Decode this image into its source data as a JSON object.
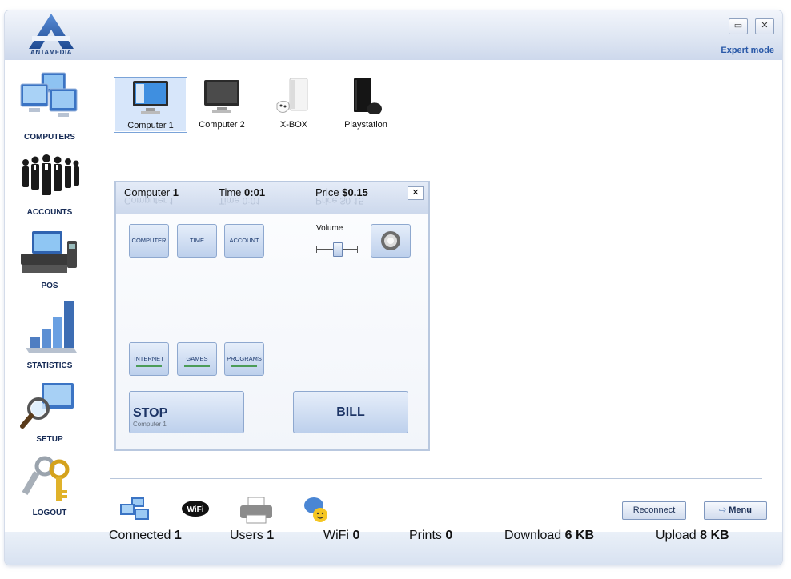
{
  "app": {
    "logo_text": "ANTAMEDIA",
    "expert_mode": "Expert mode",
    "minimize_glyph": "▭",
    "close_glyph": "✕"
  },
  "sidebar": {
    "items": [
      {
        "label": "COMPUTERS",
        "icon": "computers-icon"
      },
      {
        "label": "ACCOUNTS",
        "icon": "accounts-icon"
      },
      {
        "label": "POS",
        "icon": "pos-icon"
      },
      {
        "label": "STATISTICS",
        "icon": "statistics-icon"
      },
      {
        "label": "SETUP",
        "icon": "setup-icon"
      },
      {
        "label": "LOGOUT",
        "icon": "logout-icon"
      }
    ]
  },
  "devices": [
    {
      "label": "Computer 1",
      "icon": "monitor-on-icon",
      "selected": true
    },
    {
      "label": "Computer 2",
      "icon": "monitor-off-icon",
      "selected": false
    },
    {
      "label": "X-BOX",
      "icon": "xbox-icon",
      "selected": false
    },
    {
      "label": "Playstation",
      "icon": "playstation-icon",
      "selected": false
    }
  ],
  "panel": {
    "computer_label": "Computer",
    "computer_value": "1",
    "time_label": "Time",
    "time_value": "0:01",
    "price_label": "Price",
    "price_value": "$0.15",
    "close_glyph": "✕",
    "buttons_top": [
      "COMPUTER",
      "TIME",
      "ACCOUNT"
    ],
    "volume_label": "Volume",
    "volume_level": 0.5,
    "buttons_bottom": [
      "INTERNET",
      "GAMES",
      "PROGRAMS"
    ],
    "stop_label": "STOP",
    "stop_sub": "Computer 1",
    "bill_label": "BILL"
  },
  "toolbar": {
    "icons": [
      "computers-small-icon",
      "wifi-icon",
      "printer-icon",
      "chat-icon"
    ],
    "wifi_text": "WiFi",
    "reconnect_label": "Reconnect",
    "menu_label": "Menu"
  },
  "status": {
    "connected_label": "Connected",
    "connected_value": "1",
    "users_label": "Users",
    "users_value": "1",
    "wifi_label": "WiFi",
    "wifi_value": "0",
    "prints_label": "Prints",
    "prints_value": "0",
    "download_label": "Download",
    "download_value": "6 KB",
    "upload_label": "Upload",
    "upload_value": "8 KB"
  },
  "colors": {
    "accent": "#2a59a8",
    "nav_text": "#152a55",
    "button_text": "#1f3c70",
    "underline": "#4c9c58"
  }
}
